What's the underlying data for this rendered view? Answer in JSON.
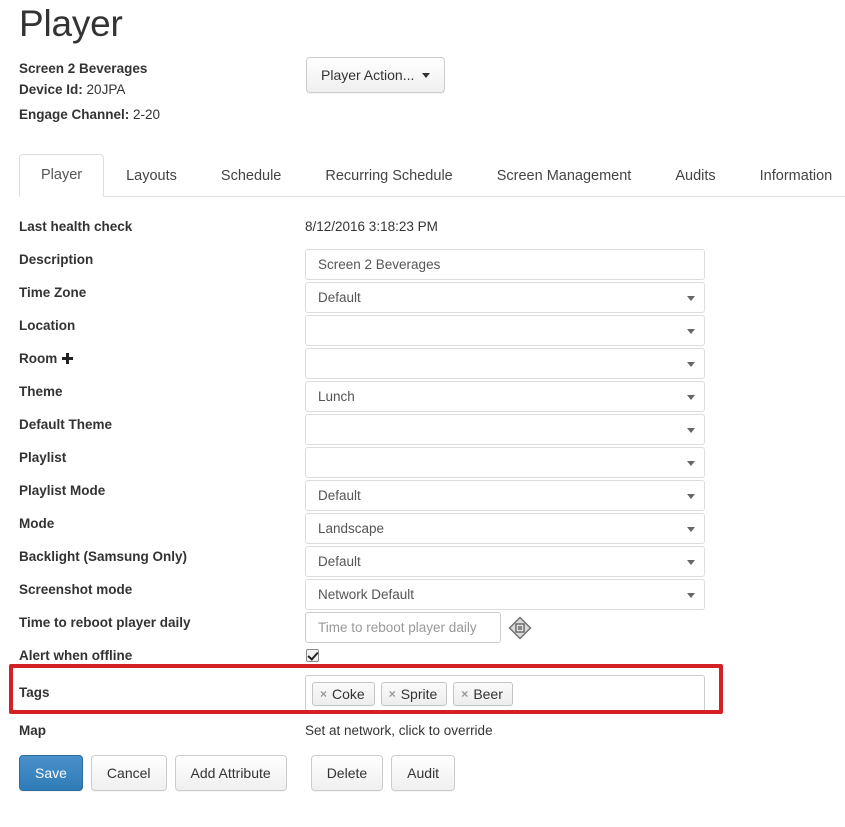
{
  "header": {
    "title": "Player",
    "screen_name": "Screen 2 Beverages",
    "device_id_label": "Device Id",
    "device_id_value": "20JPA",
    "engage_channel_label": "Engage Channel",
    "engage_channel_value": "2-20",
    "player_action_label": "Player Action..."
  },
  "tabs": [
    {
      "label": "Player",
      "active": true
    },
    {
      "label": "Layouts",
      "active": false
    },
    {
      "label": "Schedule",
      "active": false
    },
    {
      "label": "Recurring Schedule",
      "active": false
    },
    {
      "label": "Screen Management",
      "active": false
    },
    {
      "label": "Audits",
      "active": false
    },
    {
      "label": "Information",
      "active": false
    }
  ],
  "form": {
    "last_health_check": {
      "label": "Last health check",
      "value": "8/12/2016 3:18:23 PM"
    },
    "description": {
      "label": "Description",
      "value": "Screen 2 Beverages",
      "placeholder": ""
    },
    "time_zone": {
      "label": "Time Zone",
      "value": "Default"
    },
    "location": {
      "label": "Location",
      "value": ""
    },
    "room": {
      "label": "Room",
      "value": "",
      "add_icon": "plus-icon"
    },
    "theme": {
      "label": "Theme",
      "value": "Lunch"
    },
    "default_theme": {
      "label": "Default Theme",
      "value": ""
    },
    "playlist": {
      "label": "Playlist",
      "value": ""
    },
    "playlist_mode": {
      "label": "Playlist Mode",
      "value": "Default"
    },
    "mode": {
      "label": "Mode",
      "value": "Landscape"
    },
    "backlight": {
      "label": "Backlight (Samsung Only)",
      "value": "Default"
    },
    "screenshot_mode": {
      "label": "Screenshot mode",
      "value": "Network Default"
    },
    "time_to_reboot": {
      "label": "Time to reboot player daily",
      "value": "",
      "placeholder": "Time to reboot player daily",
      "icon": "time-picker-icon"
    },
    "alert_when_offline": {
      "label": "Alert when offline",
      "checked": true
    },
    "tags": {
      "label": "Tags",
      "chips": [
        "Coke",
        "Sprite",
        "Beer"
      ],
      "remove_glyph": "×"
    },
    "map": {
      "label": "Map",
      "value": "Set at network, click to override"
    }
  },
  "footer": {
    "save": "Save",
    "cancel": "Cancel",
    "add_attribute": "Add Attribute",
    "delete": "Delete",
    "audit": "Audit"
  },
  "annotation": {
    "color": "#d42027",
    "target": "Tags"
  }
}
